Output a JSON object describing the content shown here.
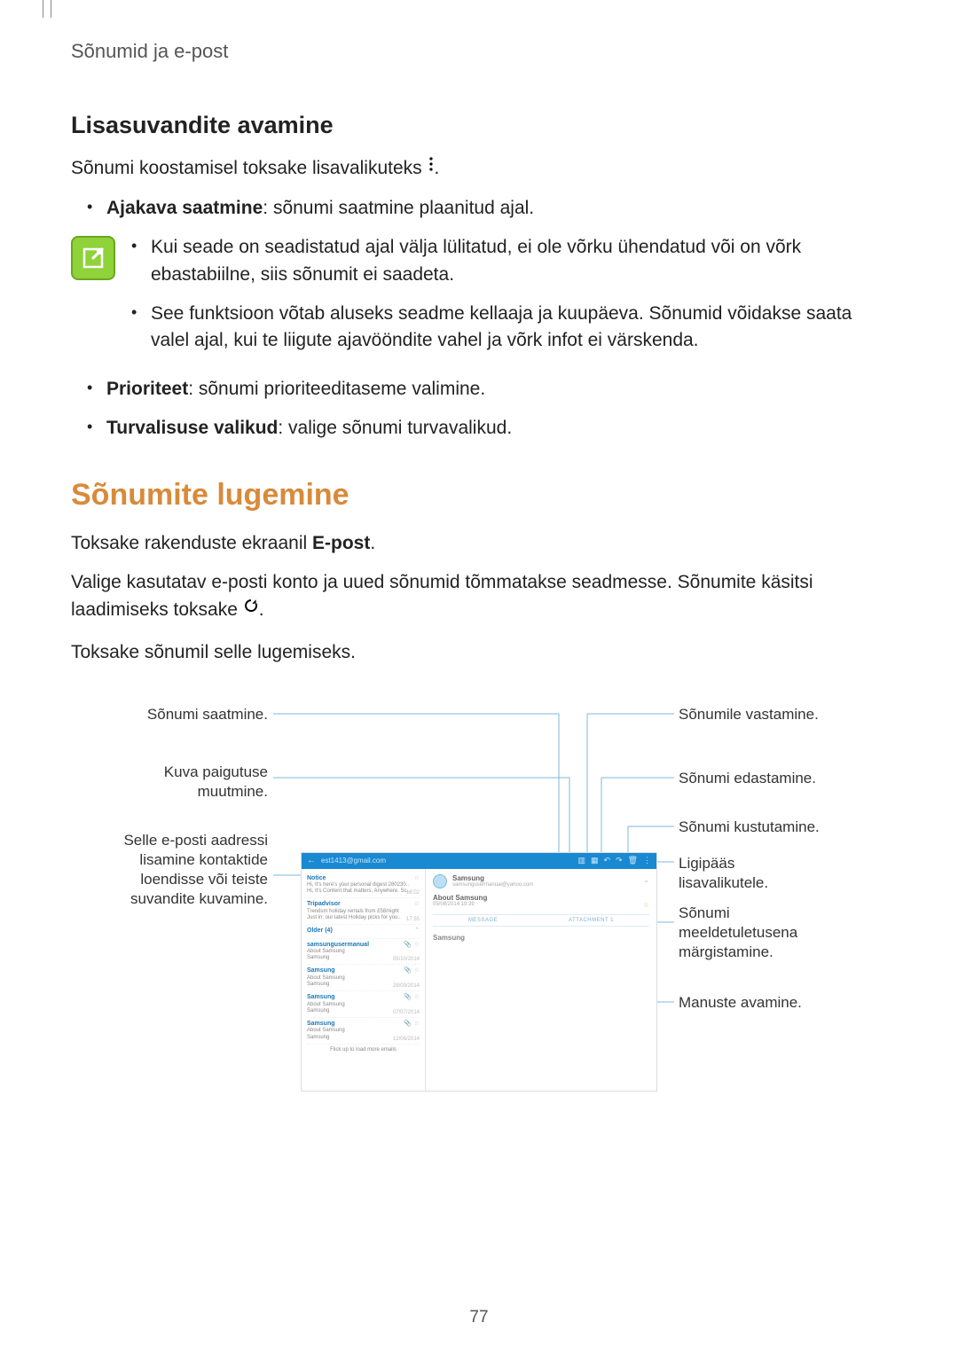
{
  "runningHead": "Sõnumid ja e-post",
  "sub1": {
    "title": "Lisasuvandite avamine",
    "intro_a": "Sõnumi koostamisel toksake lisavalikuteks ",
    "intro_b": ".",
    "bullets": {
      "b1_label": "Ajakava saatmine",
      "b1_text": ": sõnumi saatmine plaanitud ajal.",
      "note1": "Kui seade on seadistatud ajal välja lülitatud, ei ole võrku ühendatud või on võrk ebastabiilne, siis sõnumit ei saadeta.",
      "note2": "See funktsioon võtab aluseks seadme kellaaja ja kuupäeva. Sõnumid võidakse saata valel ajal, kui te liigute ajavööndite vahel ja võrk infot ei värskenda.",
      "b2_label": "Prioriteet",
      "b2_text": ": sõnumi prioriteeditaseme valimine.",
      "b3_label": "Turvalisuse valikud",
      "b3_text": ": valige sõnumi turvavalikud."
    }
  },
  "sec": {
    "title": "Sõnumite lugemine",
    "p1_a": "Toksake rakenduste ekraanil ",
    "p1_bold": "E-post",
    "p1_b": ".",
    "p2_a": "Valige kasutatav e-posti konto ja uued sõnumid tõmmatakse seadmesse. Sõnumite käsitsi laadimiseks toksake ",
    "p2_b": ".",
    "p3": "Toksake sõnumil selle lugemiseks."
  },
  "callouts": {
    "l1": "Sõnumi saatmine.",
    "l2a": "Kuva paigutuse",
    "l2b": "muutmine.",
    "l3a": "Selle e-posti aadressi",
    "l3b": "lisamine kontaktide",
    "l3c": "loendisse või teiste",
    "l3d": "suvandite kuvamine.",
    "r1": "Sõnumile vastamine.",
    "r2": "Sõnumi edastamine.",
    "r3": "Sõnumi kustutamine.",
    "r4a": "Ligipääs",
    "r4b": "lisavalikutele.",
    "r5a": "Sõnumi",
    "r5b": "meeldetuletusena",
    "r5c": "märgistamine.",
    "r6": "Manuste avamine."
  },
  "shot": {
    "account": "est1413@gmail.com",
    "item1_t1": "Notice",
    "item1_t2": "Hi, It's here's your personal digest 280230..",
    "item1_t3": "Hi, It's Content that matters. Anywhere. Sc..",
    "item1_time": "18:02",
    "item2_t1": "Tripadvisor",
    "item2_t2": "Trendsm holiday rentals from £58/night",
    "item2_t3": "Just in: our latest Holiday picks for you..",
    "item2_time": "17:55",
    "date_t": "Older (4)",
    "item3_t1": "samsungusermanual",
    "item3_t2": "About Samsung",
    "item3_t3": "Samsung",
    "item3_date": "05/10/2014",
    "item4_t1": "Samsung",
    "item4_t2": "About Samsung",
    "item4_t3": "Samsung",
    "item4_date": "28/09/2014",
    "item5_t1": "Samsung",
    "item5_t2": "About Samsung",
    "item5_t3": "Samsung",
    "item5_date": "07/07/2014",
    "item6_t1": "Samsung",
    "item6_t2": "About Samsung",
    "item6_t3": "Samsung",
    "item6_date": "12/06/2014",
    "footer": "Flick up to load more emails",
    "from_name": "Samsung",
    "from_addr": "samsungusermanual@yahoo.com",
    "subject": "About Samsung",
    "subject_meta": "05/08/2014  19:39",
    "tab1": "MESSAGE",
    "tab2": "ATTACHMENT 1",
    "msg_from": "Samsung"
  },
  "pageNum": "77"
}
